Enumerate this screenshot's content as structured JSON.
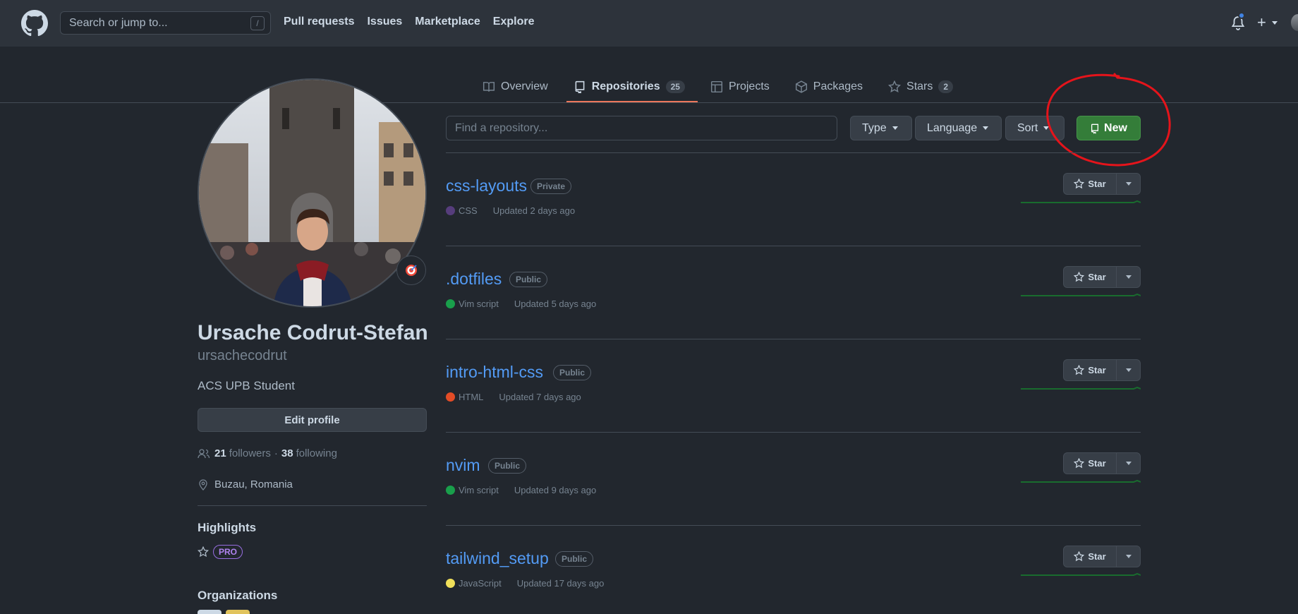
{
  "header": {
    "search_placeholder": "Search or jump to...",
    "search_shortcut": "/",
    "nav": [
      "Pull requests",
      "Issues",
      "Marketplace",
      "Explore"
    ],
    "plus": "+"
  },
  "tabs": [
    {
      "label": "Overview",
      "icon": "book-icon"
    },
    {
      "label": "Repositories",
      "icon": "repo-icon",
      "count": "25",
      "active": true
    },
    {
      "label": "Projects",
      "icon": "project-icon"
    },
    {
      "label": "Packages",
      "icon": "package-icon"
    },
    {
      "label": "Stars",
      "icon": "star-icon",
      "count": "2"
    }
  ],
  "profile": {
    "name": "Ursache Codrut-Stefan",
    "login": "ursachecodrut",
    "bio": "ACS UPB Student",
    "edit_label": "Edit profile",
    "followers_count": "21",
    "followers_label": "followers",
    "separator": "·",
    "following_count": "38",
    "following_label": "following",
    "location": "Buzau, Romania",
    "highlights_title": "Highlights",
    "pro_badge": "PRO",
    "orgs_title": "Organizations"
  },
  "filters": {
    "find_placeholder": "Find a repository...",
    "type_label": "Type",
    "language_label": "Language",
    "sort_label": "Sort",
    "new_label": "New"
  },
  "repos": [
    {
      "name": "css-layouts",
      "visibility": "Private",
      "language": "CSS",
      "lang_color": "#563d7c",
      "updated": "Updated 2 days ago"
    },
    {
      "name": ".dotfiles",
      "visibility": "Public",
      "language": "Vim script",
      "lang_color": "#199f4b",
      "updated": "Updated 5 days ago"
    },
    {
      "name": "intro-html-css",
      "visibility": "Public",
      "language": "HTML",
      "lang_color": "#e34c26",
      "updated": "Updated 7 days ago"
    },
    {
      "name": "nvim",
      "visibility": "Public",
      "language": "Vim script",
      "lang_color": "#199f4b",
      "updated": "Updated 9 days ago"
    },
    {
      "name": "tailwind_setup",
      "visibility": "Public",
      "language": "JavaScript",
      "lang_color": "#f1e05a",
      "updated": "Updated 17 days ago"
    }
  ],
  "star_label": "Star",
  "colors": {
    "accent_tab": "#ec775c",
    "new_button": "#347d39",
    "link": "#539bf5",
    "annotation": "#e5141b"
  }
}
